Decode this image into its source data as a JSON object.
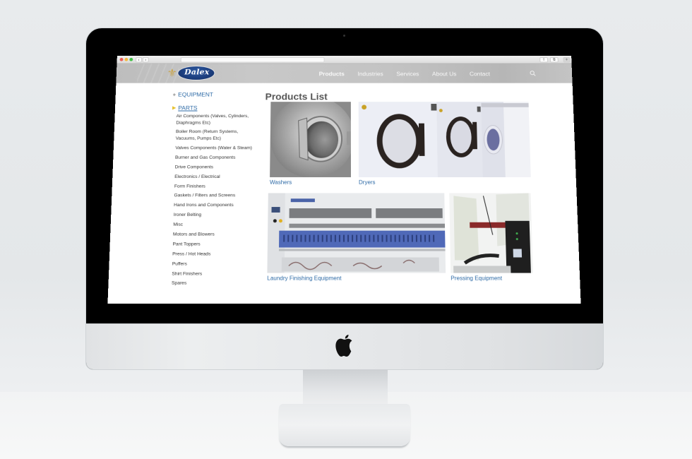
{
  "browser": {
    "back_label": "‹",
    "forward_label": "›",
    "address": "",
    "share_label": "⇧",
    "tabs_label": "⧉",
    "newtab_label": "+"
  },
  "site": {
    "logo_text": "Dalex",
    "logo_emblem": "⚜",
    "nav": [
      {
        "label": "Products",
        "active": true
      },
      {
        "label": "Industries",
        "active": false
      },
      {
        "label": "Services",
        "active": false
      },
      {
        "label": "About Us",
        "active": false
      },
      {
        "label": "Contact",
        "active": false
      }
    ],
    "search_icon": "search-icon"
  },
  "sidebar": {
    "equipment_marker": "+",
    "equipment_label": "EQUIPMENT",
    "parts_marker": "▶",
    "parts_label": "PARTS",
    "parts_items": [
      "Air Components (Valves, Cylinders, Diaphragms Etc)",
      "Boiler Room (Return Systems, Vacuums, Pumps Etc)",
      "Valves Components (Water & Steam)",
      "Burner and Gas Components",
      "Drive Components",
      "Electronics / Electrical",
      "Form Finishers",
      "Gaskets / Filters and Screens",
      "Hand Irons and Components",
      "Ironer Belting",
      "Misc",
      "Motors and Blowers",
      "Pant Toppers",
      "Press / Hot Heads",
      "Puffers",
      "Shirt Finishers",
      "Spares"
    ]
  },
  "main": {
    "title": "Products List",
    "products": [
      {
        "name": "Washers"
      },
      {
        "name": "Dryers"
      },
      {
        "name": "Laundry Finishing Equipment"
      },
      {
        "name": "Pressing Equipment"
      }
    ]
  },
  "colors": {
    "link_blue": "#2d6aa6",
    "header_gray": "#c3c3c3",
    "logo_navy": "#1c3f80",
    "parts_arrow": "#e6c12c"
  }
}
